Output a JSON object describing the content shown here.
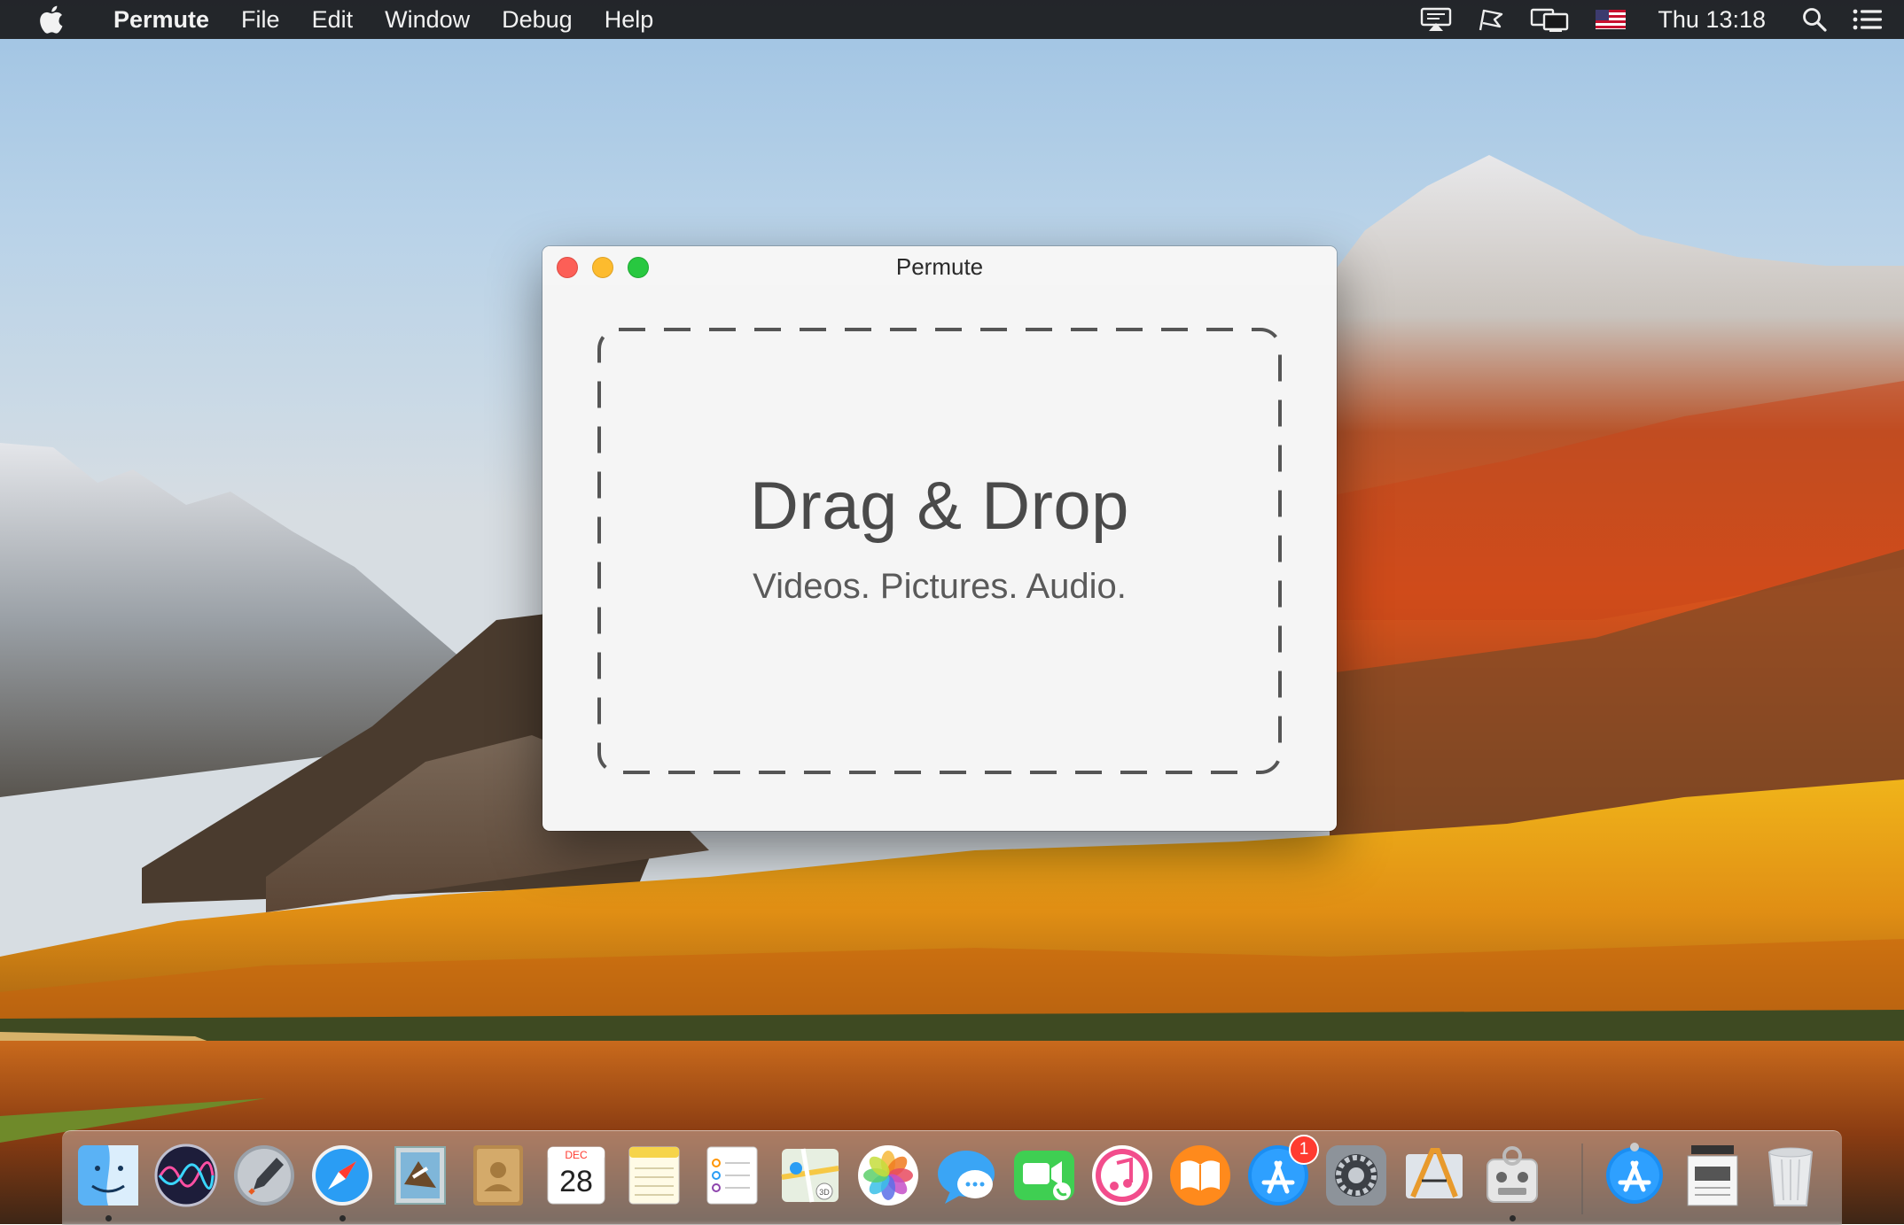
{
  "menubar": {
    "app_name": "Permute",
    "menus": [
      "File",
      "Edit",
      "Window",
      "Debug",
      "Help"
    ],
    "status_icons": [
      "airplay-display-icon",
      "flag-icon",
      "display-mirroring-icon",
      "us-flag-input-icon"
    ],
    "clock": "Thu 13:18",
    "right_icons": [
      "spotlight-search-icon",
      "notification-center-icon"
    ]
  },
  "window": {
    "title": "Permute",
    "drop_title": "Drag & Drop",
    "drop_subtitle": "Videos. Pictures. Audio."
  },
  "dock": {
    "items": [
      {
        "name": "finder",
        "running": true
      },
      {
        "name": "siri",
        "running": false
      },
      {
        "name": "launchpad",
        "running": false
      },
      {
        "name": "safari",
        "running": true
      },
      {
        "name": "mail",
        "running": false
      },
      {
        "name": "contacts",
        "running": false
      },
      {
        "name": "calendar",
        "running": false,
        "month": "DEC",
        "day": "28"
      },
      {
        "name": "notes",
        "running": false
      },
      {
        "name": "reminders",
        "running": false
      },
      {
        "name": "maps",
        "running": false
      },
      {
        "name": "photos",
        "running": false
      },
      {
        "name": "messages",
        "running": false
      },
      {
        "name": "facetime",
        "running": false
      },
      {
        "name": "itunes",
        "running": false
      },
      {
        "name": "ibooks",
        "running": false
      },
      {
        "name": "app-store",
        "running": false,
        "badge": "1"
      },
      {
        "name": "system-preferences",
        "running": false
      },
      {
        "name": "instruments",
        "running": false
      },
      {
        "name": "permute",
        "running": true
      },
      {
        "name": "app-store-downloads",
        "running": false
      },
      {
        "name": "document-stack",
        "running": false
      },
      {
        "name": "trash",
        "running": false
      }
    ]
  }
}
